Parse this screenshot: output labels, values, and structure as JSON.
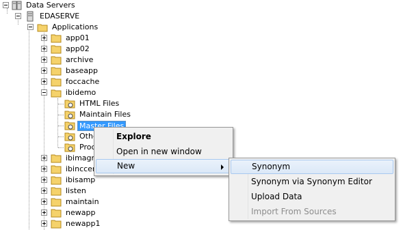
{
  "tree": {
    "root_label": "Data Servers",
    "server_label": "EDASERVE",
    "applications_label": "Applications",
    "apps": [
      "app01",
      "app02",
      "archive",
      "baseapp",
      "foccache"
    ],
    "ibidemo_label": "ibidemo",
    "ibidemo_children": [
      "HTML Files",
      "Maintain Files",
      "Master Files",
      "Othe",
      "Proc"
    ],
    "apps_after": [
      "ibimagn",
      "ibinccen",
      "ibisamp",
      "listen",
      "maintain",
      "newapp",
      "newapp1"
    ],
    "selected": "Master Files"
  },
  "context_menu": {
    "items": [
      "Explore",
      "Open in new window",
      "New"
    ]
  },
  "submenu": {
    "items": [
      "Synonym",
      "Synonym via Synonym Editor",
      "Upload Data",
      "Import From Sources"
    ]
  },
  "colors": {
    "folder": "#f5d26b",
    "selection": "#3399ff",
    "menu_bg": "#f0f0f0",
    "highlight": "#dbe8f7"
  }
}
